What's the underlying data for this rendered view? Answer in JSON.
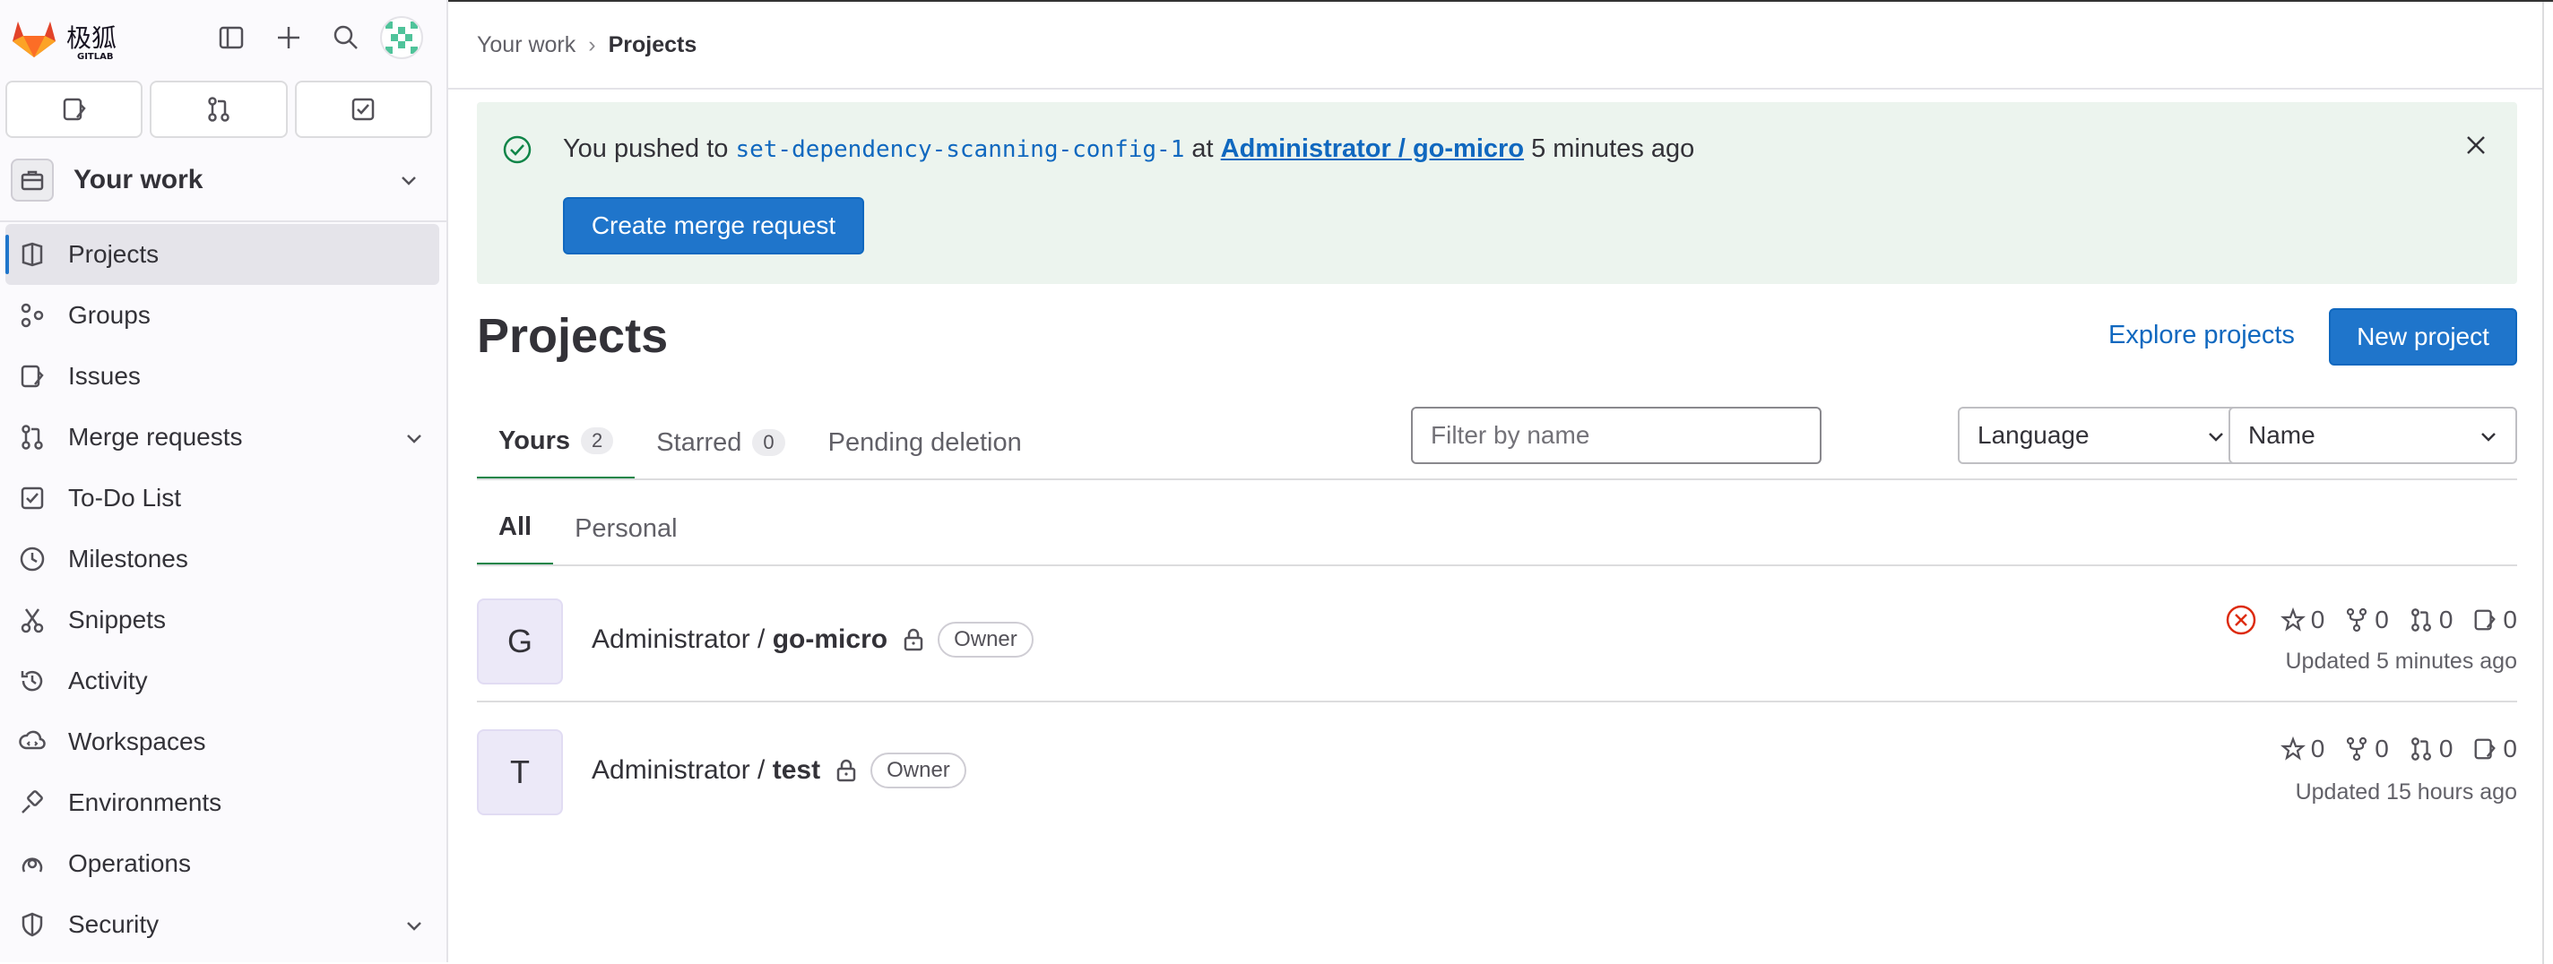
{
  "sidebar": {
    "logo_text": "极狐",
    "logo_sub": "GITLAB",
    "context_label": "Your work",
    "nav": [
      {
        "label": "Projects",
        "icon": "project-icon",
        "active": true
      },
      {
        "label": "Groups",
        "icon": "group-icon"
      },
      {
        "label": "Issues",
        "icon": "issues-icon"
      },
      {
        "label": "Merge requests",
        "icon": "merge-request-icon"
      },
      {
        "label": "To-Do List",
        "icon": "todo-icon"
      },
      {
        "label": "Milestones",
        "icon": "clock-icon"
      },
      {
        "label": "Snippets",
        "icon": "snippet-icon"
      },
      {
        "label": "Activity",
        "icon": "history-icon"
      },
      {
        "label": "Workspaces",
        "icon": "workspace-icon"
      },
      {
        "label": "Environments",
        "icon": "environment-icon"
      },
      {
        "label": "Operations",
        "icon": "deployments-icon"
      },
      {
        "label": "Security",
        "icon": "shield-icon"
      }
    ]
  },
  "breadcrumbs": {
    "parent": "Your work",
    "current": "Projects"
  },
  "alert": {
    "prefix": "You pushed to",
    "branch": "set-dependency-scanning-config-1",
    "at": "at",
    "project": "Administrator / go-micro",
    "time": "5 minutes ago",
    "button": "Create merge request"
  },
  "page": {
    "title": "Projects",
    "explore": "Explore projects",
    "new_project": "New project"
  },
  "tabs": [
    {
      "label": "Yours",
      "count": "2"
    },
    {
      "label": "Starred",
      "count": "0"
    },
    {
      "label": "Pending deletion"
    }
  ],
  "filters": {
    "search_placeholder": "Filter by name",
    "language": "Language",
    "sort": "Name"
  },
  "subtabs": {
    "all": "All",
    "personal": "Personal"
  },
  "projects": [
    {
      "initial": "G",
      "namespace": "Administrator /",
      "name": "go-micro",
      "role": "Owner",
      "stars": "0",
      "forks": "0",
      "merge_requests": "0",
      "issues": "0",
      "updated": "Updated 5 minutes ago",
      "pipeline_status": "failed"
    },
    {
      "initial": "T",
      "namespace": "Administrator /",
      "name": "test",
      "role": "Owner",
      "stars": "0",
      "forks": "0",
      "merge_requests": "0",
      "issues": "0",
      "updated": "Updated 15 hours ago"
    }
  ],
  "colors": {
    "primary": "#1f75cb",
    "success": "#108548",
    "danger": "#dd2b0e",
    "link": "#1068bf"
  }
}
